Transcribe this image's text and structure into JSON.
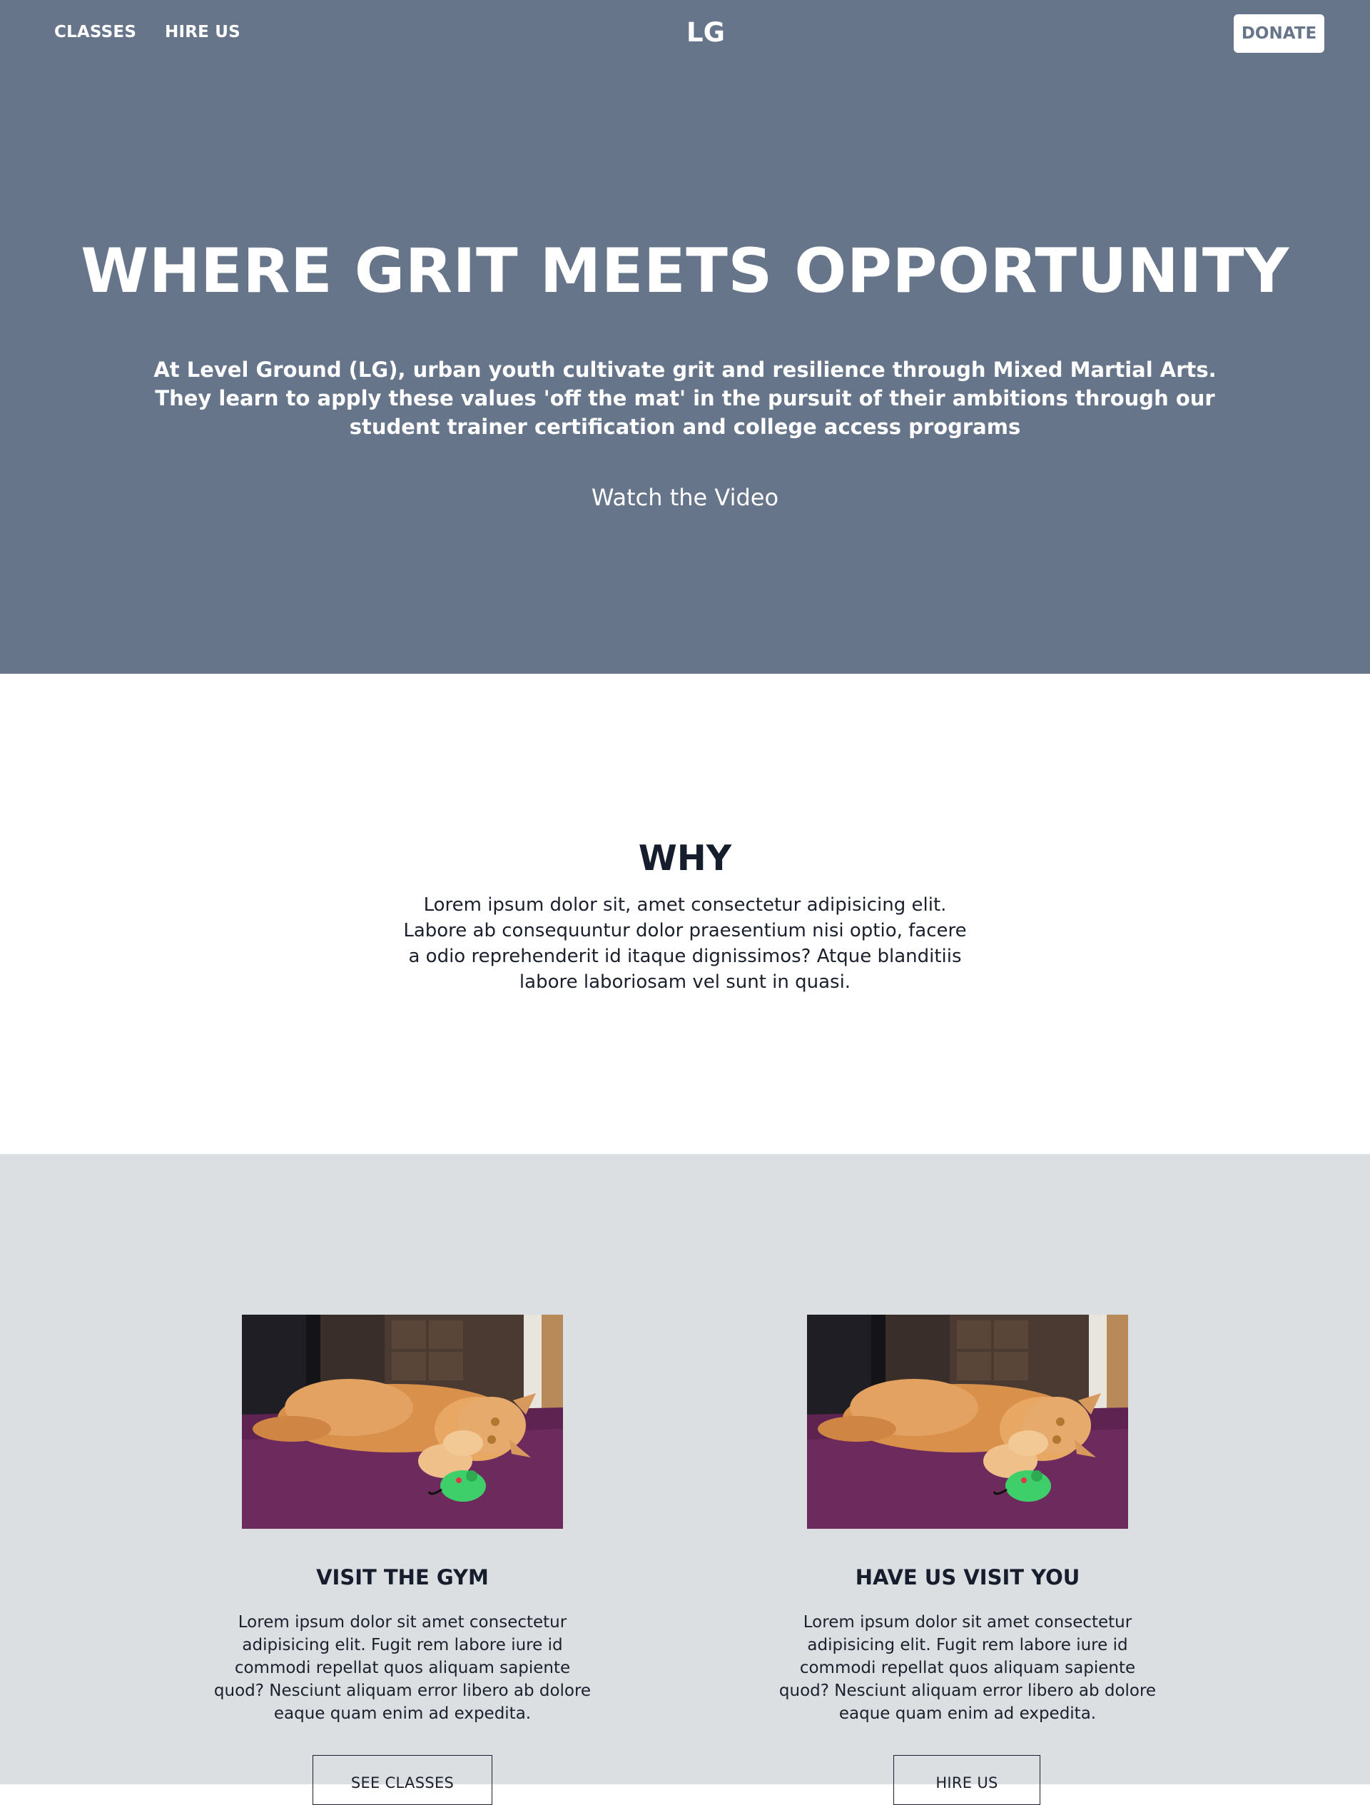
{
  "nav": {
    "classes_label": "CLASSES",
    "hire_label": "HIRE US",
    "logo": "LG",
    "donate_label": "DONATE"
  },
  "hero": {
    "title": "WHERE GRIT MEETS OPPORTUNITY",
    "subtitle": "At Level Ground (LG), urban youth cultivate grit and resilience through Mixed Martial Arts. They learn to apply these values 'off the mat' in the pursuit of their ambitions through our student trainer certification and college access programs",
    "video_link": "Watch the Video"
  },
  "why": {
    "title": "WHY",
    "text": "Lorem ipsum dolor sit, amet consectetur adipisicing elit. Labore ab consequuntur dolor praesentium nisi optio, facere a odio reprehenderit id itaque dignissimos? Atque blanditiis labore laboriosam vel sunt in quasi."
  },
  "cards": [
    {
      "title": "VISIT THE GYM",
      "text": "Lorem ipsum dolor sit amet consectetur adipisicing elit. Fugit rem labore iure id commodi repellat quos aliquam sapiente quod? Nesciunt aliquam error libero ab dolore eaque quam enim ad expedita.",
      "button": "SEE CLASSES"
    },
    {
      "title": "HAVE US VISIT YOU",
      "text": "Lorem ipsum dolor sit amet consectetur adipisicing elit. Fugit rem labore iure id commodi repellat quos aliquam sapiente quod? Nesciunt aliquam error libero ab dolore eaque quam enim ad expedita.",
      "button": "HIRE US"
    }
  ],
  "colors": {
    "hero_bg": "#667589",
    "cards_bg": "#dcdfe2",
    "text_dark": "#161d2c",
    "carpet": "#6d2a5c",
    "cat_fur": "#d8904a",
    "toy_mouse": "#3fcf6a"
  },
  "icons": {
    "card_image": "cat-photo"
  }
}
